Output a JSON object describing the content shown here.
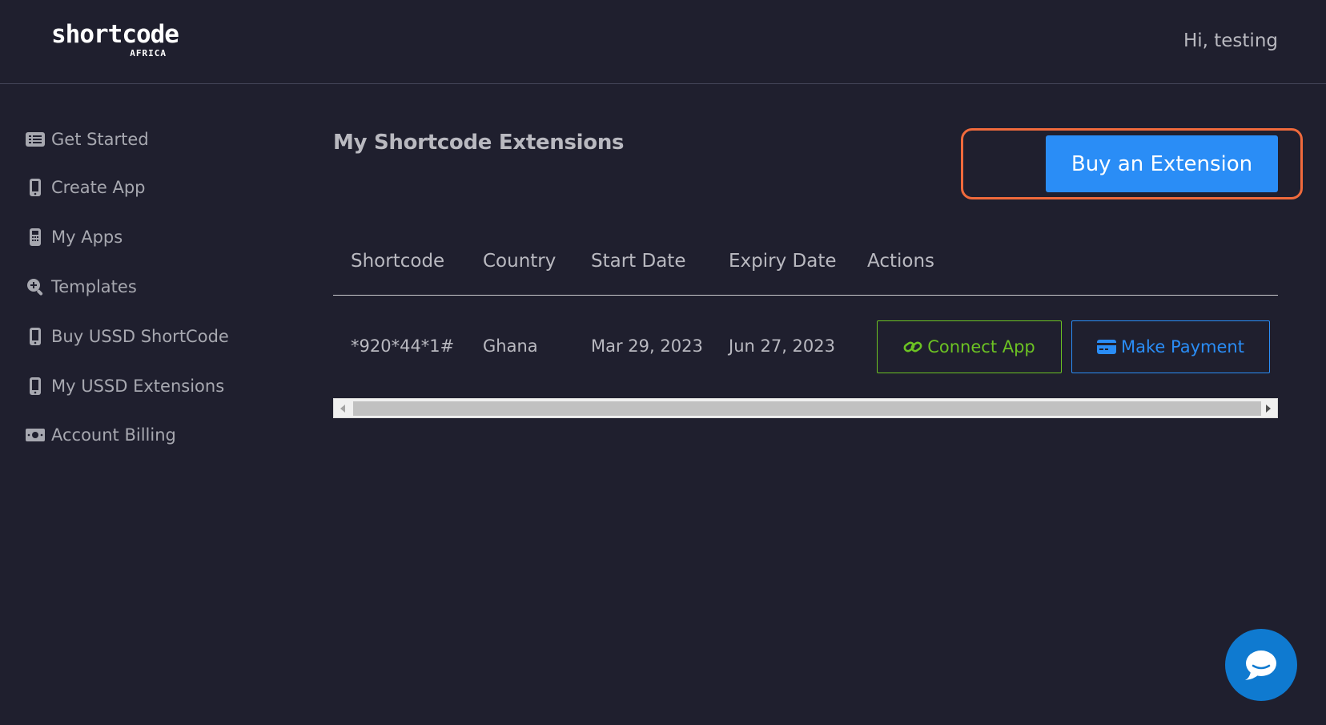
{
  "brand": {
    "logo_text": "shortcode",
    "logo_subtext": "AFRICA"
  },
  "header": {
    "greeting": "Hi, testing"
  },
  "sidebar": {
    "items": [
      {
        "label": "Get Started",
        "icon": "list-icon"
      },
      {
        "label": "Create App",
        "icon": "mobile-icon"
      },
      {
        "label": "My Apps",
        "icon": "calculator-icon"
      },
      {
        "label": "Templates",
        "icon": "search-plus-icon"
      },
      {
        "label": "Buy USSD ShortCode",
        "icon": "mobile-icon"
      },
      {
        "label": "My USSD Extensions",
        "icon": "mobile-icon"
      },
      {
        "label": "Account Billing",
        "icon": "money-bill-icon"
      }
    ]
  },
  "main": {
    "title": "My Shortcode Extensions",
    "buy_button_label": "Buy an Extension",
    "table": {
      "columns": [
        "Shortcode",
        "Country",
        "Start Date",
        "Expiry Date",
        "Actions"
      ],
      "rows": [
        {
          "shortcode": "*920*44*1#",
          "country": "Ghana",
          "start_date": "Mar 29, 2023",
          "expiry_date": "Jun 27, 2023",
          "connect_label": "Connect App",
          "payment_label": "Make Payment"
        }
      ]
    }
  },
  "colors": {
    "background": "#1f1f2e",
    "primary": "#2a8df6",
    "success": "#6cc223",
    "highlight": "#f06a3c",
    "chat": "#0f7ad0"
  }
}
